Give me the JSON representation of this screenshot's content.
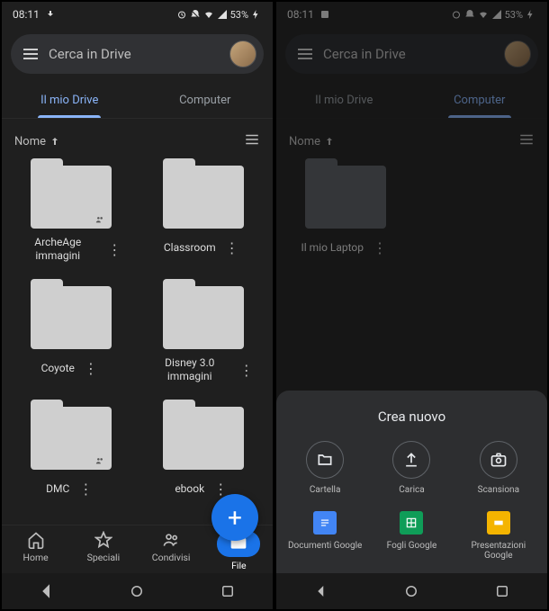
{
  "status": {
    "time": "08:11",
    "battery": "53%"
  },
  "search": {
    "placeholder": "Cerca in Drive"
  },
  "left": {
    "tabs": {
      "drive": "Il mio Drive",
      "computer": "Computer"
    },
    "sort": "Nome",
    "folders": [
      {
        "name": "ArcheAge immagini",
        "shared": true
      },
      {
        "name": "Classroom",
        "shared": false
      },
      {
        "name": "Coyote",
        "shared": false
      },
      {
        "name": "Disney 3.0 immagini",
        "shared": false
      },
      {
        "name": "DMC",
        "shared": true
      },
      {
        "name": "ebook",
        "shared": false
      }
    ],
    "nav": {
      "home": "Home",
      "starred": "Speciali",
      "shared": "Condivisi",
      "files": "File"
    }
  },
  "right": {
    "tabs": {
      "drive": "Il mio Drive",
      "computer": "Computer"
    },
    "sort": "Nome",
    "folders": [
      {
        "name": "Il mio Laptop",
        "shared": false
      }
    ],
    "sheet": {
      "title": "Crea nuovo",
      "items": {
        "folder": "Cartella",
        "upload": "Carica",
        "scan": "Scansiona",
        "docs": "Documenti Google",
        "sheets": "Fogli Google",
        "slides": "Presentazioni Google"
      }
    }
  }
}
